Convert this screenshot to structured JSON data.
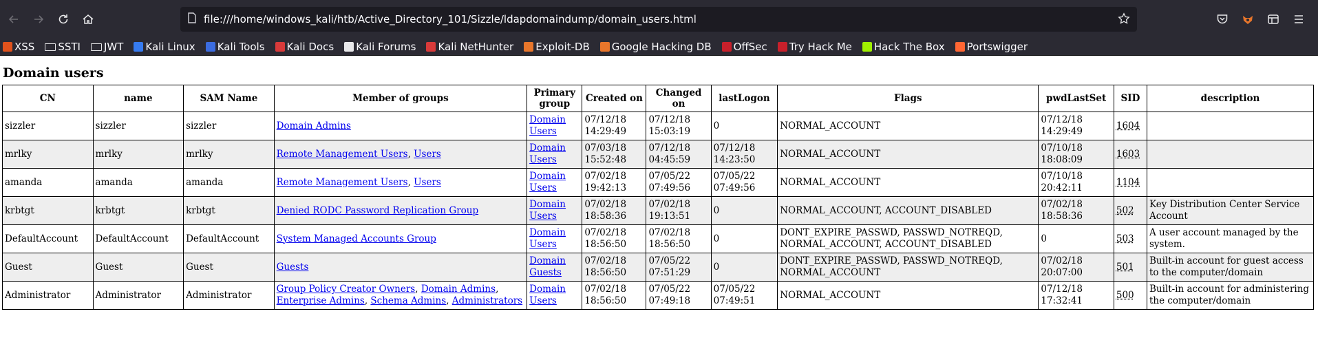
{
  "browser": {
    "url": "file:///home/windows_kali/htb/Active_Directory_101/Sizzle/ldapdomaindump/domain_users.html",
    "bookmarks": [
      {
        "label": "XSS",
        "icon": "xss-favicon-icon",
        "color": "#e0521c"
      },
      {
        "label": "SSTI",
        "icon": "folder-icon",
        "color": ""
      },
      {
        "label": "JWT",
        "icon": "folder-icon",
        "color": ""
      },
      {
        "label": "Kali Linux",
        "icon": "kali-dragon-icon",
        "color": "#367bf0"
      },
      {
        "label": "Kali Tools",
        "icon": "kali-tools-icon",
        "color": "#3b6ce0"
      },
      {
        "label": "Kali Docs",
        "icon": "kali-docs-icon",
        "color": "#d83a3a"
      },
      {
        "label": "Kali Forums",
        "icon": "kali-forums-icon",
        "color": "#e8e8ea"
      },
      {
        "label": "Kali NetHunter",
        "icon": "nethunter-icon",
        "color": "#d83a3a"
      },
      {
        "label": "Exploit-DB",
        "icon": "exploit-db-icon",
        "color": "#e8762b"
      },
      {
        "label": "Google Hacking DB",
        "icon": "ghdb-icon",
        "color": "#e8762b"
      },
      {
        "label": "OffSec",
        "icon": "offsec-icon",
        "color": "#c8202b"
      },
      {
        "label": "Try Hack Me",
        "icon": "tryhackme-icon",
        "color": "#c8202b"
      },
      {
        "label": "Hack The Box",
        "icon": "hackthebox-icon",
        "color": "#9fef00"
      },
      {
        "label": "Portswigger",
        "icon": "portswigger-icon",
        "color": "#ff6633"
      }
    ]
  },
  "page": {
    "title": "Domain users",
    "columns": [
      "CN",
      "name",
      "SAM Name",
      "Member of groups",
      "Primary group",
      "Created on",
      "Changed on",
      "lastLogon",
      "Flags",
      "pwdLastSet",
      "SID",
      "description"
    ],
    "rows": [
      {
        "cn": "sizzler",
        "name": "sizzler",
        "sam": "sizzler",
        "groups": [
          "Domain Admins"
        ],
        "primary": "Domain Users",
        "created": "07/12/18 14:29:49",
        "changed": "07/12/18 15:03:19",
        "lastlogon": "0",
        "flags": "NORMAL_ACCOUNT",
        "pwdlastset": "07/12/18 14:29:49",
        "sid": "1604",
        "description": ""
      },
      {
        "cn": "mrlky",
        "name": "mrlky",
        "sam": "mrlky",
        "groups": [
          "Remote Management Users",
          "Users"
        ],
        "primary": "Domain Users",
        "created": "07/03/18 15:52:48",
        "changed": "07/12/18 04:45:59",
        "lastlogon": "07/12/18 14:23:50",
        "flags": "NORMAL_ACCOUNT",
        "pwdlastset": "07/10/18 18:08:09",
        "sid": "1603",
        "description": ""
      },
      {
        "cn": "amanda",
        "name": "amanda",
        "sam": "amanda",
        "groups": [
          "Remote Management Users",
          "Users"
        ],
        "primary": "Domain Users",
        "created": "07/02/18 19:42:13",
        "changed": "07/05/22 07:49:56",
        "lastlogon": "07/05/22 07:49:56",
        "flags": "NORMAL_ACCOUNT",
        "pwdlastset": "07/10/18 20:42:11",
        "sid": "1104",
        "description": ""
      },
      {
        "cn": "krbtgt",
        "name": "krbtgt",
        "sam": "krbtgt",
        "groups": [
          "Denied RODC Password Replication Group"
        ],
        "primary": "Domain Users",
        "created": "07/02/18 18:58:36",
        "changed": "07/02/18 19:13:51",
        "lastlogon": "0",
        "flags": "NORMAL_ACCOUNT, ACCOUNT_DISABLED",
        "pwdlastset": "07/02/18 18:58:36",
        "sid": "502",
        "description": "Key Distribution Center Service Account"
      },
      {
        "cn": "DefaultAccount",
        "name": "DefaultAccount",
        "sam": "DefaultAccount",
        "groups": [
          "System Managed Accounts Group"
        ],
        "primary": "Domain Users",
        "created": "07/02/18 18:56:50",
        "changed": "07/02/18 18:56:50",
        "lastlogon": "0",
        "flags": "DONT_EXPIRE_PASSWD, PASSWD_NOTREQD, NORMAL_ACCOUNT, ACCOUNT_DISABLED",
        "pwdlastset": "0",
        "sid": "503",
        "description": "A user account managed by the system."
      },
      {
        "cn": "Guest",
        "name": "Guest",
        "sam": "Guest",
        "groups": [
          "Guests"
        ],
        "primary": "Domain Guests",
        "created": "07/02/18 18:56:50",
        "changed": "07/05/22 07:51:29",
        "lastlogon": "0",
        "flags": "DONT_EXPIRE_PASSWD, PASSWD_NOTREQD, NORMAL_ACCOUNT",
        "pwdlastset": "07/02/18 20:07:00",
        "sid": "501",
        "description": "Built-in account for guest access to the computer/domain"
      },
      {
        "cn": "Administrator",
        "name": "Administrator",
        "sam": "Administrator",
        "groups": [
          "Group Policy Creator Owners",
          "Domain Admins",
          "Enterprise Admins",
          "Schema Admins",
          "Administrators"
        ],
        "primary": "Domain Users",
        "created": "07/02/18 18:56:50",
        "changed": "07/05/22 07:49:18",
        "lastlogon": "07/05/22 07:49:51",
        "flags": "NORMAL_ACCOUNT",
        "pwdlastset": "07/12/18 17:32:41",
        "sid": "500",
        "description": "Built-in account for administering the computer/domain"
      }
    ]
  }
}
